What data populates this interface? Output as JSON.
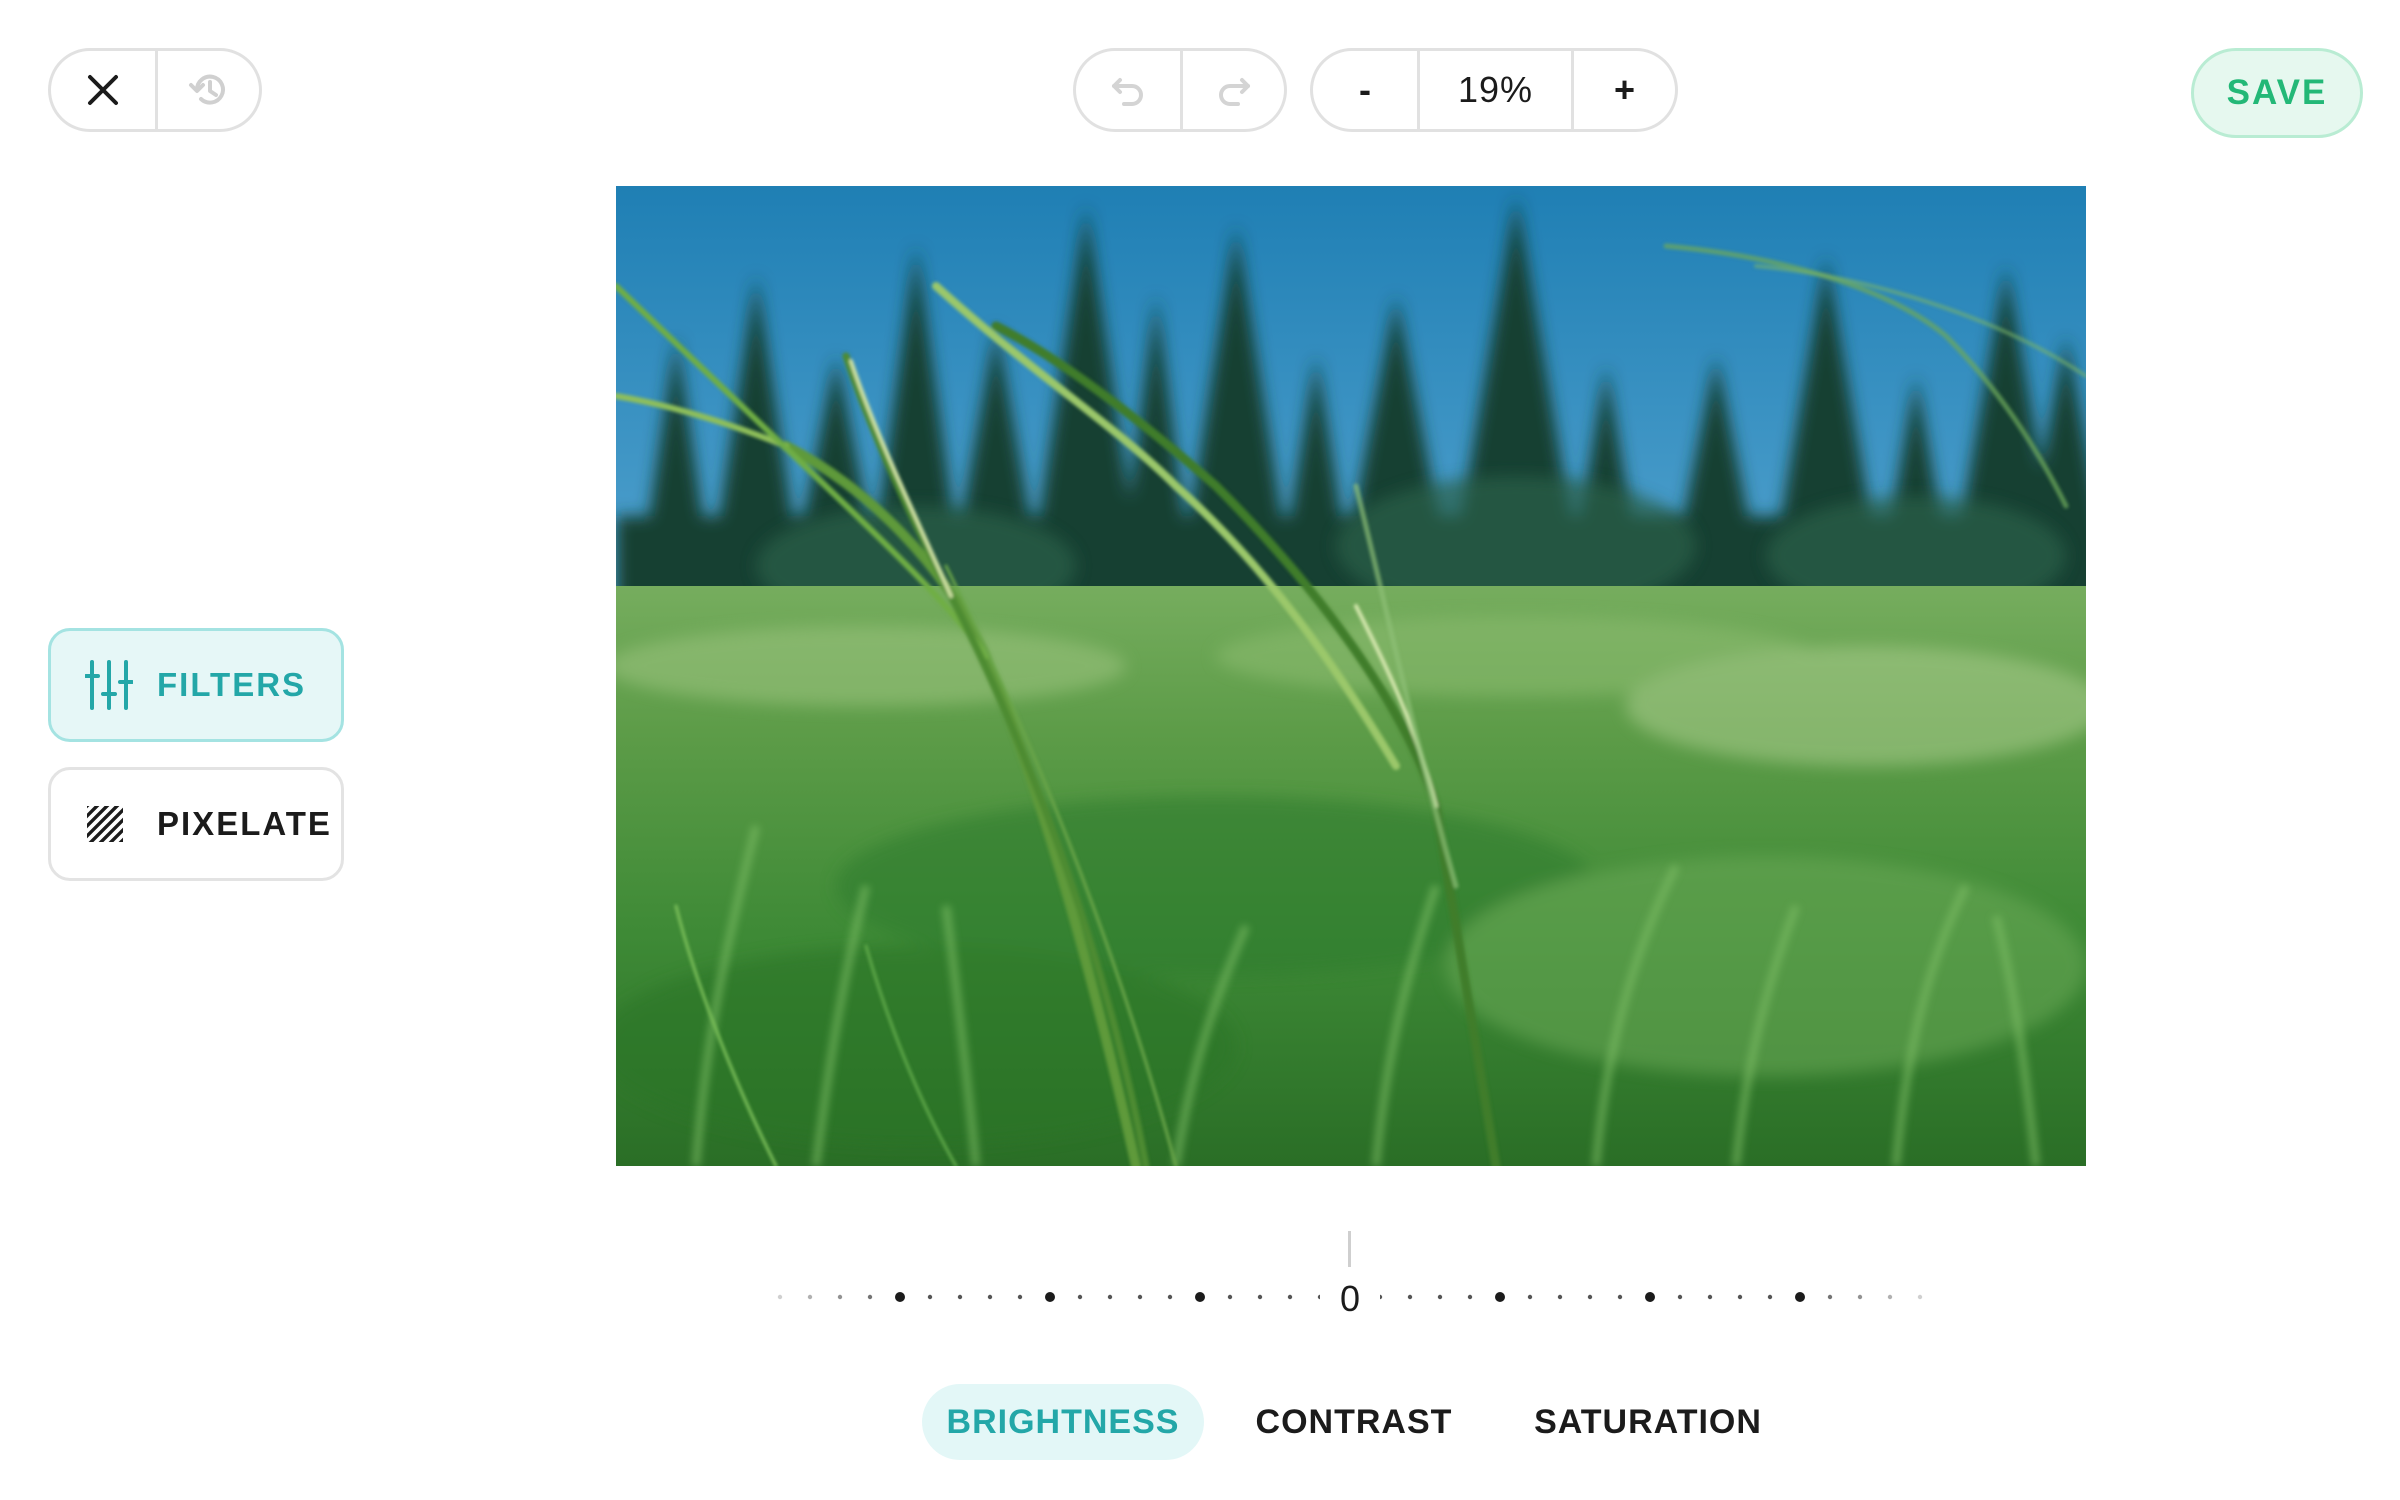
{
  "toolbar": {
    "close_icon": "close-icon",
    "history_icon": "history-icon",
    "undo_icon": "undo-icon",
    "redo_icon": "redo-icon",
    "zoom_out_label": "-",
    "zoom_value": "19%",
    "zoom_in_label": "+",
    "save_label": "SAVE"
  },
  "tools": [
    {
      "label": "FILTERS",
      "icon": "sliders-icon",
      "active": true
    },
    {
      "label": "PIXELATE",
      "icon": "pixelate-icon",
      "active": false
    }
  ],
  "canvas": {
    "image": "grass-field-photo"
  },
  "slider": {
    "value": "0"
  },
  "filters": {
    "tabs": [
      "BRIGHTNESS",
      "CONTRAST",
      "SATURATION"
    ],
    "active_index": 0
  },
  "colors": {
    "accent_teal": "#23a7a8",
    "save_green": "#23b877"
  }
}
